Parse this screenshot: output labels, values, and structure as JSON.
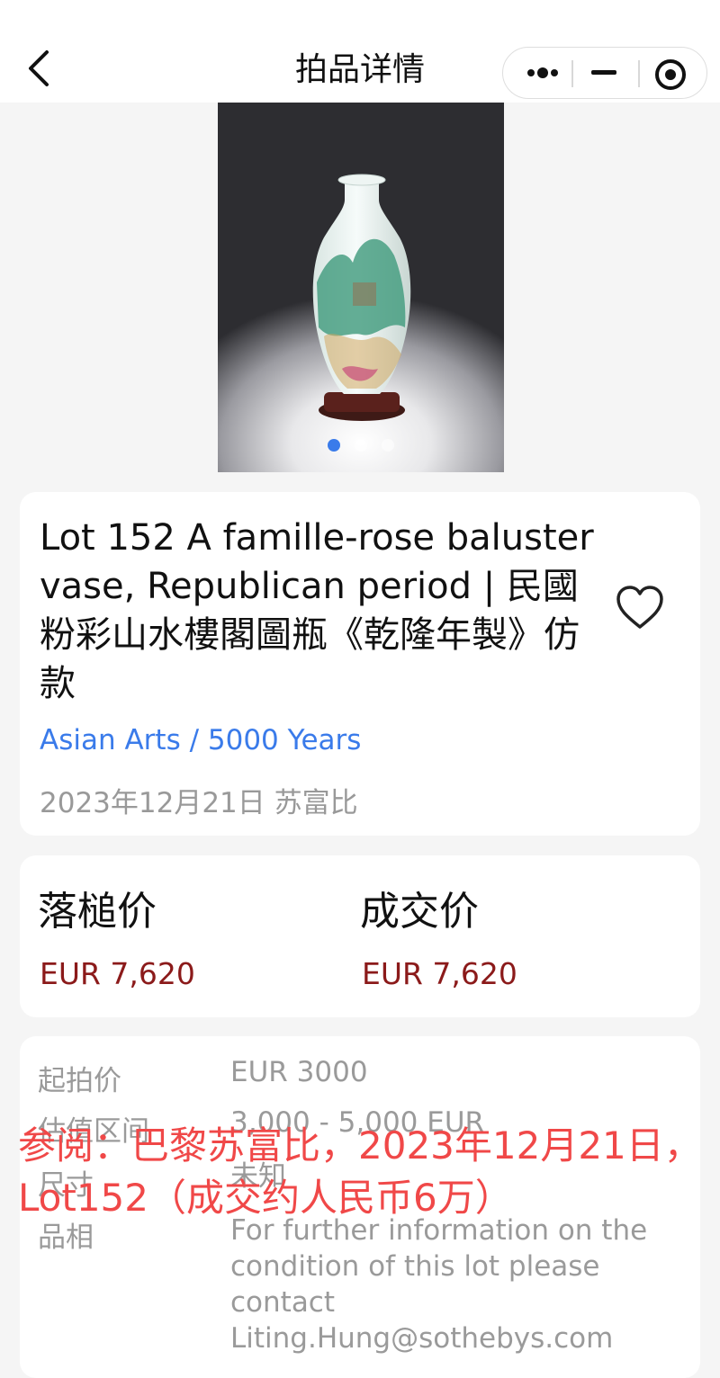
{
  "navbar": {
    "title": "拍品详情"
  },
  "gallery": {
    "image_alt": "vase",
    "dot_count": 3,
    "active_index": 0
  },
  "lot": {
    "title": "Lot 152 A famille-rose baluster vase, Republican period | 民國 粉彩山水樓閣圖瓶《乾隆年製》仿款",
    "category": "Asian Arts / 5000 Years",
    "date_house": "2023年12月21日 苏富比",
    "favorited": false
  },
  "prices": {
    "hammer_label": "落槌价",
    "hammer_value": "EUR 7,620",
    "sold_label": "成交价",
    "sold_value": "EUR 7,620"
  },
  "details": {
    "rows": [
      {
        "label": "起拍价",
        "value": "EUR 3000"
      },
      {
        "label": "估值区间",
        "value": "3,000 - 5,000 EUR"
      },
      {
        "label": "尺寸",
        "value": "未知"
      },
      {
        "label": "品相",
        "value": "For further information on the condition of this lot please contact Liting.Hung@sothebys.com"
      }
    ]
  },
  "watermark": {
    "text": "参阅：巴黎苏富比，2023年12月21日，Lot152（成交约人民币6万）"
  },
  "colors": {
    "accent_blue": "#3a7bea",
    "price_red": "#8b1a1a",
    "watermark_red": "#f04848"
  }
}
